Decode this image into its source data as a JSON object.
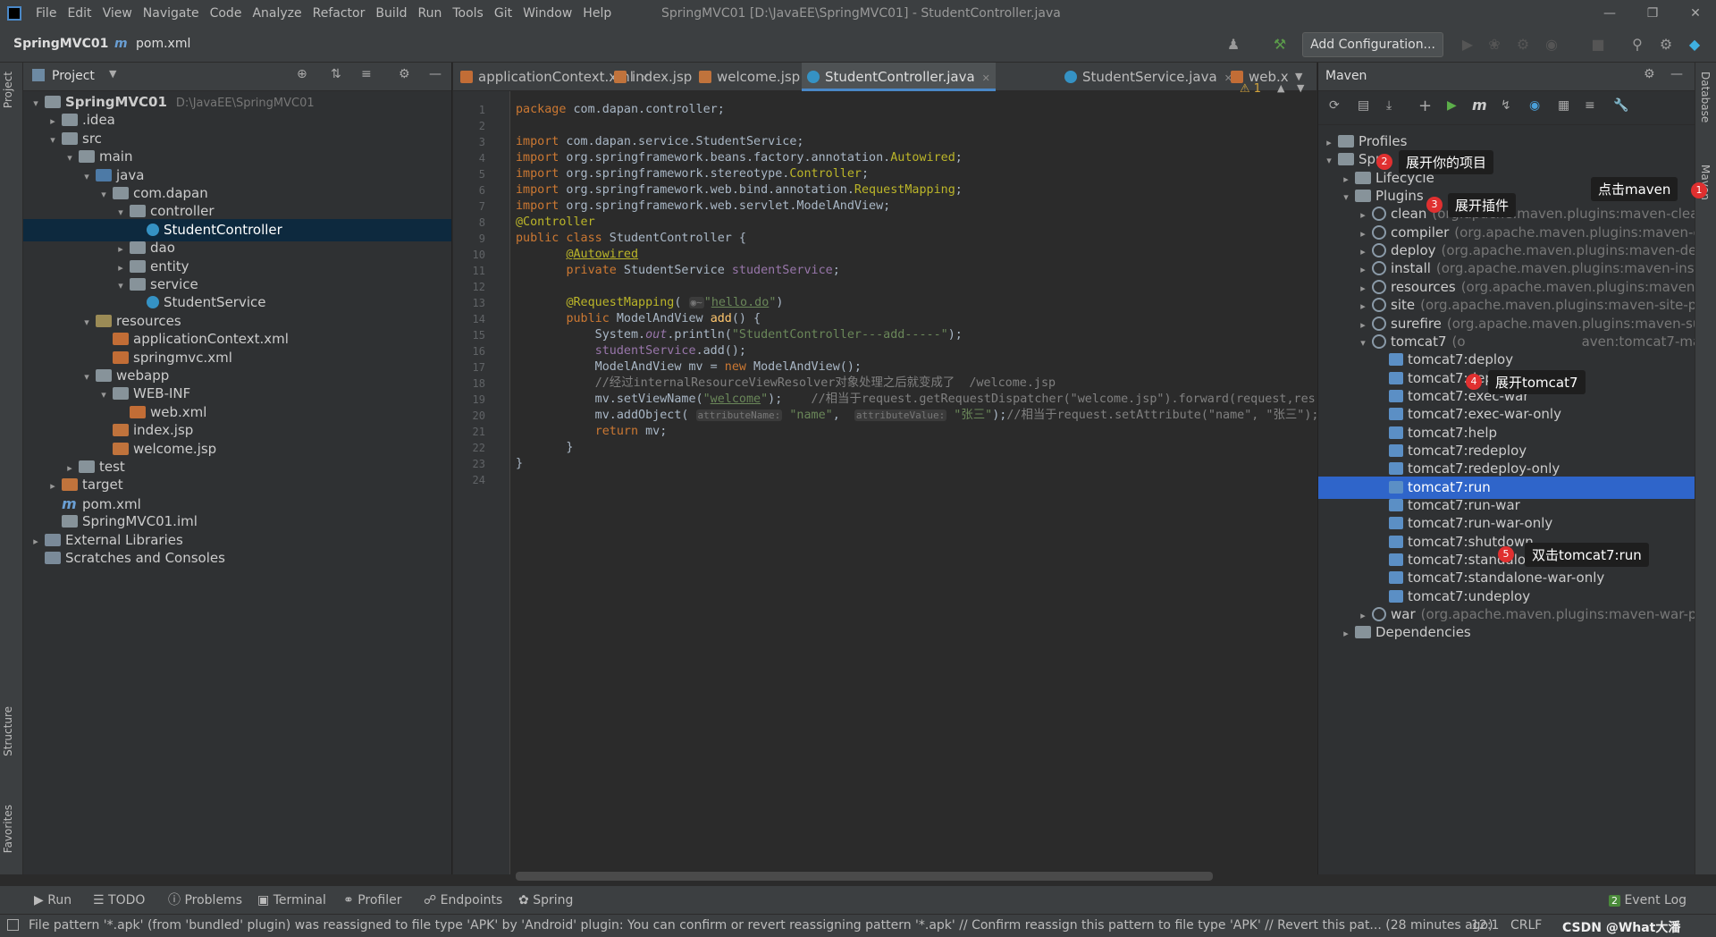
{
  "menubar": {
    "items": [
      "File",
      "Edit",
      "View",
      "Navigate",
      "Code",
      "Analyze",
      "Refactor",
      "Build",
      "Run",
      "Tools",
      "Git",
      "Window",
      "Help"
    ],
    "title": "SpringMVC01 [D:\\JavaEE\\SpringMVC01] - StudentController.java"
  },
  "navbar": {
    "project": "SpringMVC01",
    "file": "pom.xml",
    "add_config": "Add Configuration..."
  },
  "project_panel": {
    "title": "Project",
    "tree": [
      {
        "label": "SpringMVC01",
        "hint": "D:\\JavaEE\\SpringMVC01",
        "bold": true
      },
      {
        "label": ".idea"
      },
      {
        "label": "src"
      },
      {
        "label": "main"
      },
      {
        "label": "java"
      },
      {
        "label": "com.dapan"
      },
      {
        "label": "controller"
      },
      {
        "label": "StudentController"
      },
      {
        "label": "dao"
      },
      {
        "label": "entity"
      },
      {
        "label": "service"
      },
      {
        "label": "StudentService"
      },
      {
        "label": "resources"
      },
      {
        "label": "applicationContext.xml"
      },
      {
        "label": "springmvc.xml"
      },
      {
        "label": "webapp"
      },
      {
        "label": "WEB-INF"
      },
      {
        "label": "web.xml"
      },
      {
        "label": "index.jsp"
      },
      {
        "label": "welcome.jsp"
      },
      {
        "label": "test"
      },
      {
        "label": "target"
      },
      {
        "label": "pom.xml"
      },
      {
        "label": "SpringMVC01.iml"
      },
      {
        "label": "External Libraries"
      },
      {
        "label": "Scratches and Consoles"
      }
    ]
  },
  "left_stripe": {
    "project": "Project",
    "structure": "Structure",
    "favorites": "Favorites"
  },
  "right_stripe": {
    "database": "Database",
    "maven": "Maven"
  },
  "editor": {
    "tabs": [
      "applicationContext.xml",
      "index.jsp",
      "welcome.jsp",
      "StudentController.java",
      "StudentService.java",
      "web.x"
    ],
    "warnings": "1"
  },
  "maven": {
    "title": "Maven",
    "rows": [
      {
        "label": "Profiles"
      },
      {
        "label": "Spr"
      },
      {
        "label": "Lifecycle"
      },
      {
        "label": "Plugins"
      },
      {
        "label": "clean",
        "hint": "(org.apache.maven.plugins:maven-clean-p"
      },
      {
        "label": "compiler",
        "hint": "(org.apache.maven.plugins:maven-com"
      },
      {
        "label": "deploy",
        "hint": "(org.apache.maven.plugins:maven-deplo"
      },
      {
        "label": "install",
        "hint": "(org.apache.maven.plugins:maven-install"
      },
      {
        "label": "resources",
        "hint": "(org.apache.maven.plugins:maven-reso"
      },
      {
        "label": "site",
        "hint": "(org.apache.maven.plugins:maven-site-plug"
      },
      {
        "label": "surefire",
        "hint": "(org.apache.maven.plugins:maven-suref"
      },
      {
        "label": "tomcat7",
        "hint": "(o"
      },
      {
        "label": "tomcat7:deploy"
      },
      {
        "label": "tomcat7:deploy-only"
      },
      {
        "label": "tomcat7:exec-war"
      },
      {
        "label": "tomcat7:exec-war-only"
      },
      {
        "label": "tomcat7:help"
      },
      {
        "label": "tomcat7:redeploy"
      },
      {
        "label": "tomcat7:redeploy-only"
      },
      {
        "label": "tomcat7:run"
      },
      {
        "label": "tomcat7:run-war"
      },
      {
        "label": "tomcat7:run-war-only"
      },
      {
        "label": "tomcat7:shutdown"
      },
      {
        "label": "tomcat7:standalone-war"
      },
      {
        "label": "tomcat7:standalone-war-only"
      },
      {
        "label": "tomcat7:undeploy"
      },
      {
        "label": "war",
        "hint": "(org.apache.maven.plugins:maven-war-plug"
      },
      {
        "label": "Dependencies"
      }
    ],
    "tomcat_tail": "aven:tomcat7-ma"
  },
  "callouts": [
    {
      "num": "1",
      "text": "点击maven"
    },
    {
      "num": "2",
      "text": "展开你的项目"
    },
    {
      "num": "3",
      "text": "展开插件"
    },
    {
      "num": "4",
      "text": "展开tomcat7"
    },
    {
      "num": "5",
      "text": "双击tomcat7:run"
    }
  ],
  "bottom_tabs": [
    "Run",
    "TODO",
    "Problems",
    "Terminal",
    "Profiler",
    "Endpoints",
    "Spring"
  ],
  "event_log": {
    "count": "2",
    "label": "Event Log"
  },
  "status": {
    "message": "File pattern '*.apk' (from 'bundled' plugin) was reassigned to file type 'APK' by 'Android' plugin: You can confirm or revert reassigning pattern '*.apk' // Confirm reassign this pattern to file type 'APK' // Revert this pat... (28 minutes ago)",
    "position": "12:1",
    "line_sep": "CRLF",
    "watermark": "CSDN @What大潘"
  }
}
